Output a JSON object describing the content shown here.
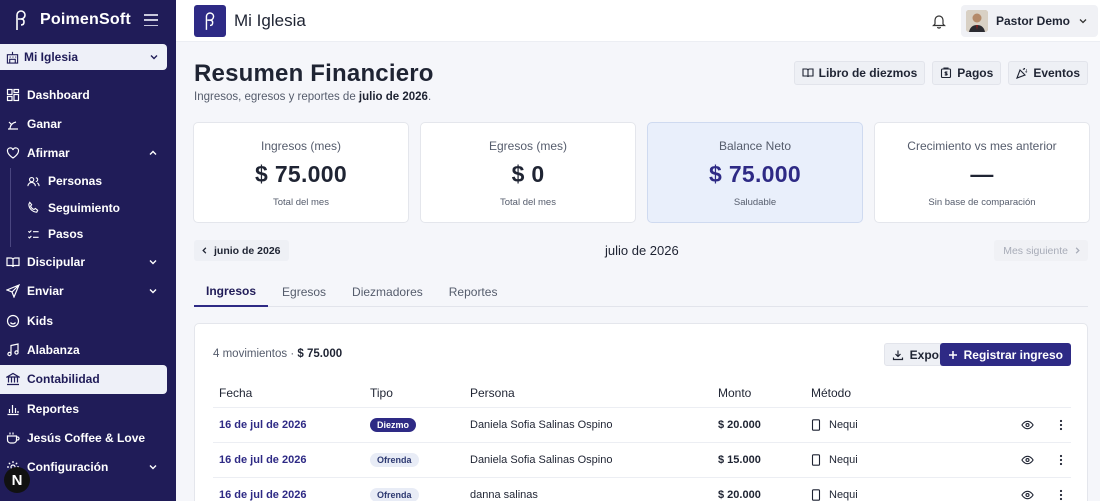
{
  "brand": {
    "name": "PoimenSoft"
  },
  "church_select": {
    "label": "Mi Iglesia"
  },
  "nav": {
    "dashboard": "Dashboard",
    "ganar": "Ganar",
    "afirmar": "Afirmar",
    "afirmar_sub": {
      "personas": "Personas",
      "seguimiento": "Seguimiento",
      "pasos": "Pasos"
    },
    "discipular": "Discipular",
    "enviar": "Enviar",
    "kids": "Kids",
    "alabanza": "Alabanza",
    "contabilidad": "Contabilidad",
    "reportes": "Reportes",
    "coffee": "Jesús Coffee & Love",
    "configuracion": "Configuración"
  },
  "badge_letter": "N",
  "topbar": {
    "title": "Mi Iglesia",
    "user": "Pastor Demo"
  },
  "header": {
    "title": "Resumen Financiero",
    "subtitle_prefix": "Ingresos, egresos y reportes de ",
    "subtitle_month": "julio de 2026",
    "subtitle_suffix": ".",
    "buttons": {
      "libro": "Libro de diezmos",
      "pagos": "Pagos",
      "eventos": "Eventos"
    }
  },
  "cards": [
    {
      "title": "Ingresos (mes)",
      "value": "$ 75.000",
      "sub": "Total del mes"
    },
    {
      "title": "Egresos (mes)",
      "value": "$ 0",
      "sub": "Total del mes"
    },
    {
      "title": "Balance Neto",
      "value": "$ 75.000",
      "sub": "Saludable"
    },
    {
      "title": "Crecimiento vs mes anterior",
      "value": "—",
      "sub": "Sin base de comparación"
    }
  ],
  "month_nav": {
    "prev": "junio de 2026",
    "current": "julio de 2026",
    "next": "Mes siguiente"
  },
  "tabs": [
    "Ingresos",
    "Egresos",
    "Diezmadores",
    "Reportes"
  ],
  "table": {
    "summary_prefix": "4 movimientos · ",
    "summary_total": "$ 75.000",
    "export_label": "Exportar",
    "register_label": "Registrar ingreso",
    "headers": {
      "fecha": "Fecha",
      "tipo": "Tipo",
      "persona": "Persona",
      "monto": "Monto",
      "metodo": "Método"
    },
    "rows": [
      {
        "fecha": "16 de jul de 2026",
        "tipo": "Diezmo",
        "persona": "Daniela Sofia Salinas Ospino",
        "monto": "$ 20.000",
        "metodo": "Nequi"
      },
      {
        "fecha": "16 de jul de 2026",
        "tipo": "Ofrenda",
        "persona": "Daniela Sofia Salinas Ospino",
        "monto": "$ 15.000",
        "metodo": "Nequi"
      },
      {
        "fecha": "16 de jul de 2026",
        "tipo": "Ofrenda",
        "persona": "danna salinas",
        "monto": "$ 20.000",
        "metodo": "Nequi"
      }
    ]
  }
}
